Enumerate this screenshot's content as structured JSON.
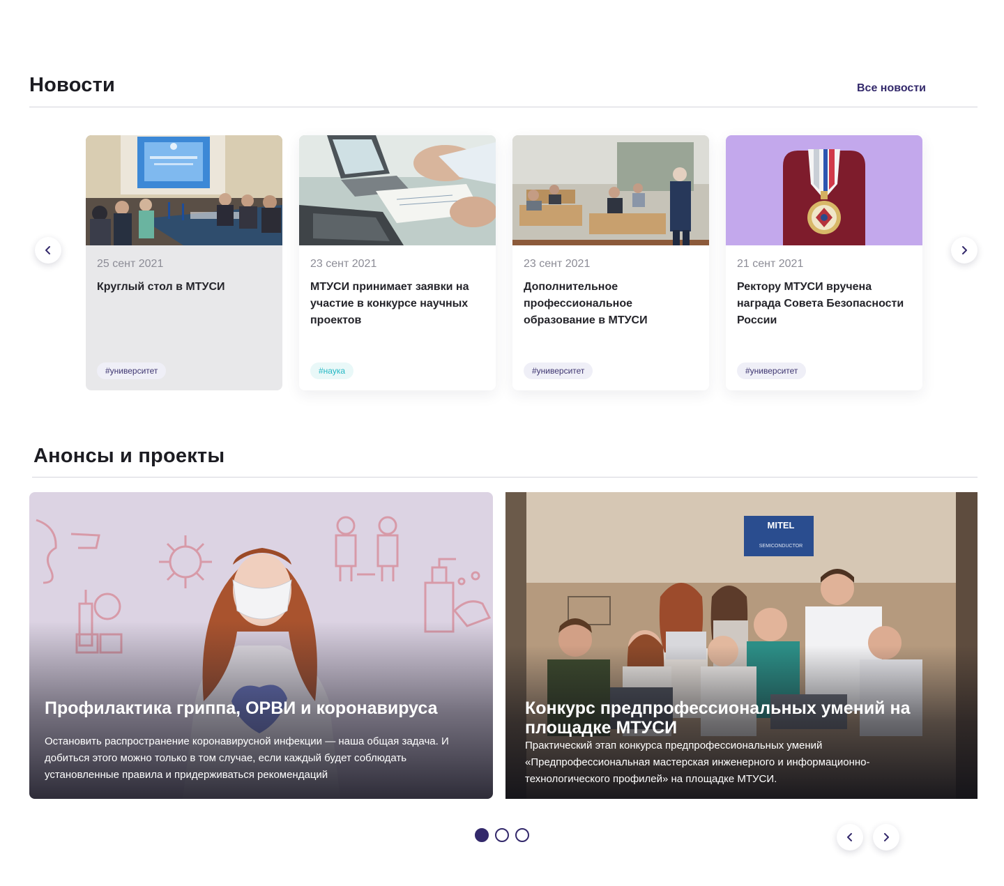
{
  "news": {
    "title": "Новости",
    "all_link": "Все новости",
    "prev_icon": "chevron-left-icon",
    "next_icon": "chevron-right-icon",
    "cards": [
      {
        "date": "25 сент 2021",
        "title": "Круглый стол в МТУСИ",
        "tag": "#университет"
      },
      {
        "date": "23 сент 2021",
        "title": "МТУСИ принимает заявки на участие в конкурсе научных проектов",
        "tag": "#наука"
      },
      {
        "date": "23 сент 2021",
        "title": "Дополнительное профессиональное образование в МТУСИ",
        "tag": "#университет"
      },
      {
        "date": "21 сент 2021",
        "title": "Ректору МТУСИ вручена награда Совета Безопасности России",
        "tag": "#университет"
      }
    ]
  },
  "announcements": {
    "title": "Анонсы и проекты",
    "items": [
      {
        "title": "Профилактика гриппа, ОРВИ и коронавируса",
        "description": "Остановить распространение коронавирусной инфекции — наша общая задача. И добиться этого можно только в том случае, если каждый будет соблюдать установленные правила и придерживаться рекомендаций"
      },
      {
        "title": "Конкурс предпрофессиональных умений на площадке МТУСИ",
        "description": "Практический этап конкурса предпрофессиональных умений «Предпрофессиональная мастерская инженерного и информационно-технологического профилей» на площадке МТУСИ."
      }
    ],
    "sign_text": "MITEL",
    "sign_subtext": "SEMICONDUCTOR",
    "pagination": {
      "pages": 3,
      "current": 1
    }
  },
  "colors": {
    "accent": "#33296b",
    "science_tag": "#25b8c4",
    "medal_bg": "#c3a8ec"
  }
}
